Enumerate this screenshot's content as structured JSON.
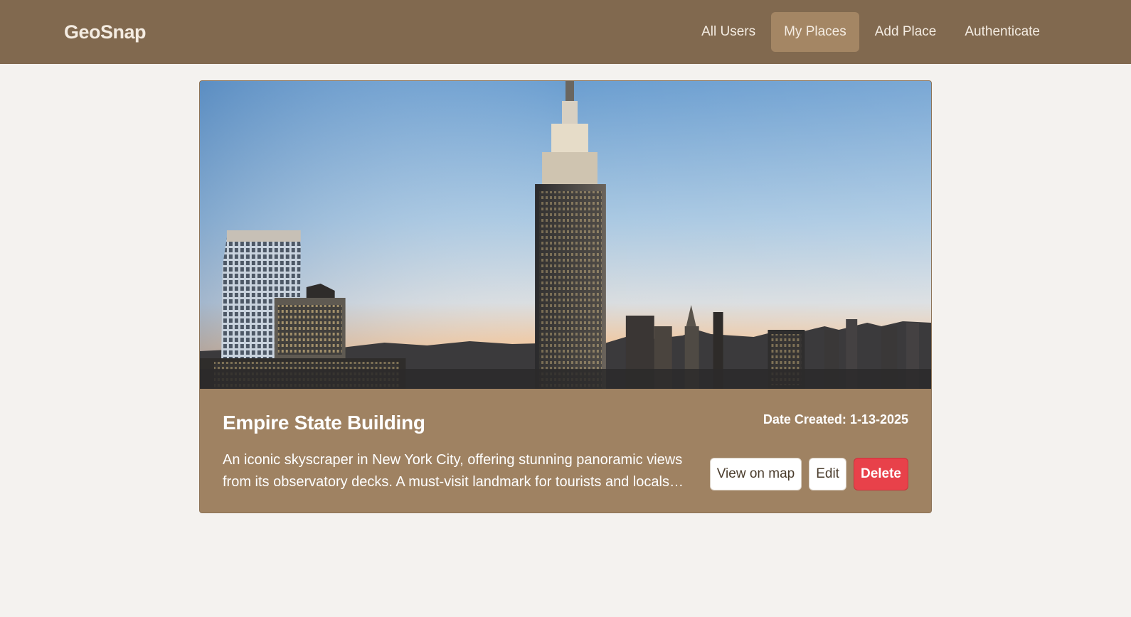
{
  "app": {
    "logo": "GeoSnap"
  },
  "nav": {
    "items": [
      {
        "label": "All Users",
        "active": false
      },
      {
        "label": "My Places",
        "active": true
      },
      {
        "label": "Add Place",
        "active": false
      },
      {
        "label": "Authenticate",
        "active": false
      }
    ]
  },
  "colors": {
    "navbar_bg": "#81694f",
    "nav_active_bg": "#a48664",
    "card_bg": "#9f8262",
    "page_bg": "#f4f2ef",
    "delete_bg": "#e8414a"
  },
  "place": {
    "title": "Empire State Building",
    "date_created": "Date Created: 1-13-2025",
    "description": "An iconic skyscraper in New York City, offering stunning panoramic views from its observatory decks. A must-visit landmark for tourists and locals alike.",
    "image_subject": "Empire State Building skyline at sunset",
    "actions": {
      "view_on_map": "View on map",
      "edit": "Edit",
      "delete": "Delete"
    }
  }
}
